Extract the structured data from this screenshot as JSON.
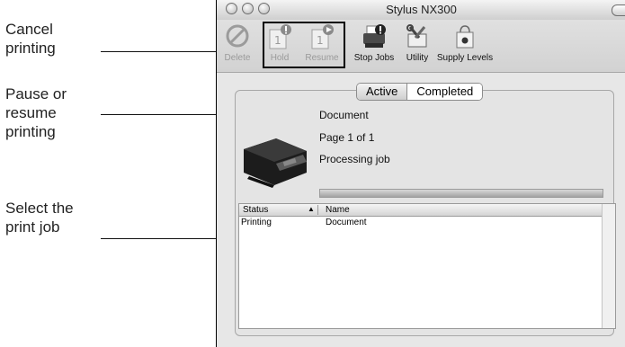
{
  "callouts": {
    "cancel": [
      "Cancel",
      "printing"
    ],
    "pause": [
      "Pause or",
      "resume",
      "printing"
    ],
    "select": [
      "Select the",
      "print job"
    ]
  },
  "window": {
    "title": "Stylus NX300"
  },
  "toolbar": {
    "delete": "Delete",
    "hold": "Hold",
    "resume": "Resume",
    "stop_jobs": "Stop Jobs",
    "utility": "Utility",
    "supply_levels": "Supply Levels"
  },
  "tabs": {
    "active": "Active",
    "completed": "Completed"
  },
  "job": {
    "name": "Document",
    "page": "Page 1 of 1",
    "status": "Processing job"
  },
  "table": {
    "headers": {
      "status": "Status",
      "name": "Name"
    },
    "rows": [
      {
        "status": "Printing",
        "name": "Document"
      }
    ]
  }
}
